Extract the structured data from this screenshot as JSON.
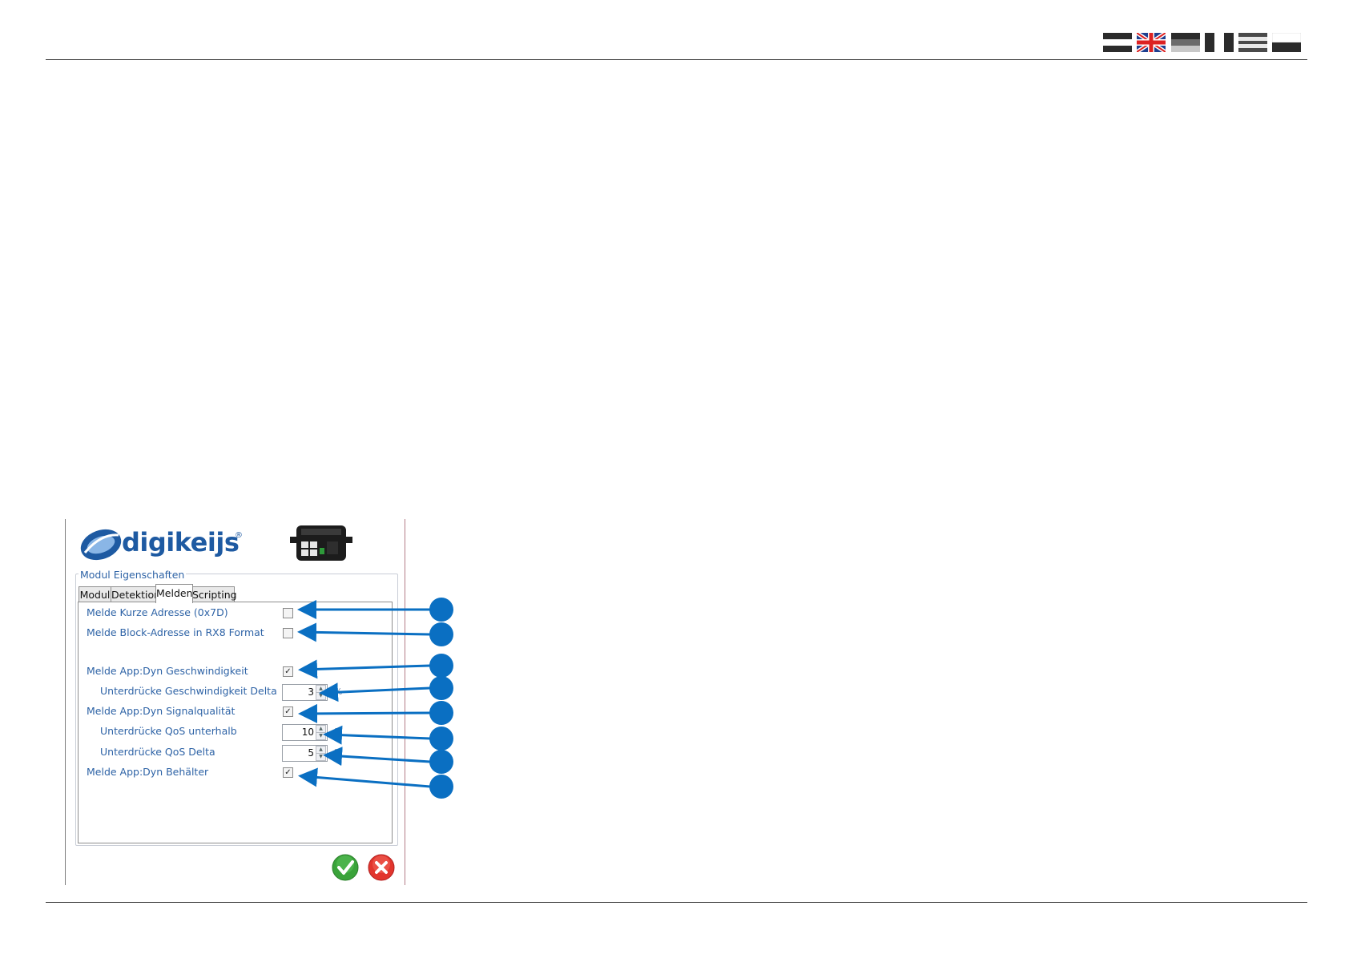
{
  "header": {
    "flags": [
      {
        "name": "flag-de-icon"
      },
      {
        "name": "flag-gb-icon"
      },
      {
        "name": "flag-3-icon"
      },
      {
        "name": "flag-4-icon"
      },
      {
        "name": "flag-5-icon"
      },
      {
        "name": "flag-6-icon"
      }
    ]
  },
  "dialog": {
    "brand": "digikeijs",
    "brand_mark": "®",
    "group_title": "Modul Eigenschaften",
    "tabs": [
      {
        "label": "Modul"
      },
      {
        "label": "Detektion"
      },
      {
        "label": "Melden",
        "active": true
      },
      {
        "label": "Scripting"
      }
    ],
    "options": [
      {
        "label": "Melde Kurze Adresse (0x7D)",
        "checked": false
      },
      {
        "label": "Melde Block-Adresse in RX8 Format",
        "checked": false
      },
      {
        "label": "Melde App:Dyn Geschwindigkeit",
        "checked": true
      },
      {
        "label": "Unterdrücke Geschwindigkeit Delta",
        "value": "3",
        "unit": "%"
      },
      {
        "label": "Melde App:Dyn Signalqualität",
        "checked": true
      },
      {
        "label": "Unterdrücke QoS unterhalb",
        "value": "10",
        "unit": "%"
      },
      {
        "label": "Unterdrücke QoS Delta",
        "value": "5",
        "unit": "%"
      },
      {
        "label": "Melde App:Dyn Behälter",
        "checked": true
      }
    ],
    "check_mark": "✓",
    "spin_up": "▲",
    "spin_down": "▼",
    "ok_icon": "check-circle-icon",
    "cancel_icon": "x-circle-icon"
  },
  "colors": {
    "callout": "#0a6fc2",
    "label": "#2e63a6",
    "brand": "#1e5aa2",
    "ok": "#3aa33a",
    "cancel": "#e2352d"
  }
}
